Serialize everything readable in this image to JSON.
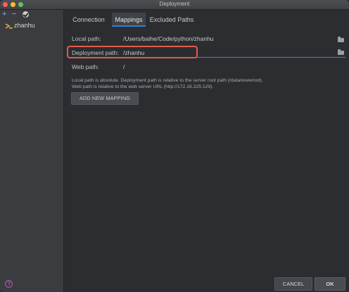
{
  "window": {
    "title": "Deployment"
  },
  "sidebar": {
    "toolbar": {
      "add": "+",
      "remove": "−"
    },
    "servers": [
      {
        "label": "zhanhu"
      }
    ]
  },
  "tabs": [
    {
      "label": "Connection"
    },
    {
      "label": "Mappings"
    },
    {
      "label": "Excluded Paths"
    }
  ],
  "mappings": {
    "local_path": {
      "label": "Local path:",
      "value": "/Users/baihe/Code/python/zhanhu"
    },
    "deployment_path": {
      "label": "Deployment path:",
      "value": "/zhanhu"
    },
    "web_path": {
      "label": "Web path:",
      "value": "/"
    },
    "note_line1": "Local path is absolute. Deployment path is relative to the server root path (/data/wwwroot).",
    "note_line2": "Web path is relative to the web server URL (http://172.16.225.129).",
    "add_button": "ADD NEW MAPPING"
  },
  "footer": {
    "cancel": "CANCEL",
    "ok": "OK",
    "help": "?"
  },
  "colors": {
    "accent": "#2f7ed8",
    "highlight": "#e35b4b"
  }
}
